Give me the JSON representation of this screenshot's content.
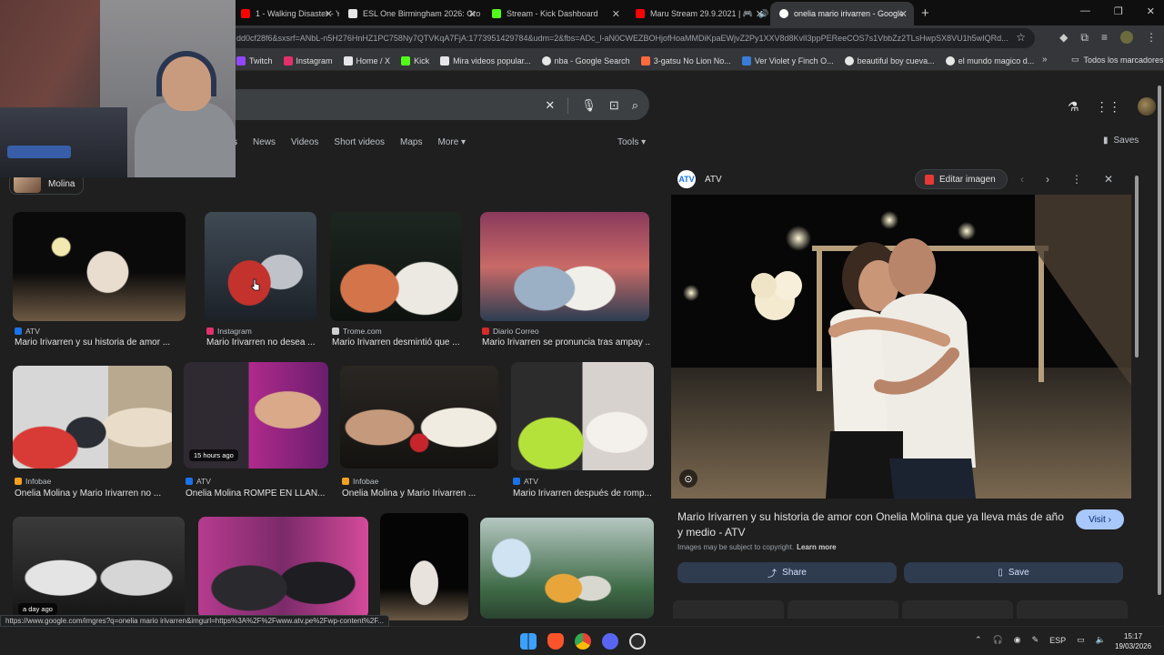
{
  "tabs": [
    {
      "title": "1 - Walking Disaster - Yo",
      "color": "#ff0000"
    },
    {
      "title": "ESL One Birmingham 2026: Gro",
      "color": "#e6e6e6"
    },
    {
      "title": "Stream - Kick Dashboard",
      "color": "#53fc18"
    },
    {
      "title": "Maru Stream 29.9.2021 | 🎮",
      "color": "#ff0000"
    },
    {
      "title": "onelia mario irivarren - Google",
      "color": "#4285f4"
    }
  ],
  "address_bar": {
    "url": "dd0cf28f6&sxsrf=ANbL-n5H276HnHZ1PC758Ny7QTVKqA7FjA:1773951429784&udm=2&fbs=ADc_l-aN0CWEZBOHjofHoaMMDiKpaEWjvZ2Py1XXV8d8KvlI3ppPEReeCOS7s1VbbZz2TLsHwpSX8VU1h5wIQRd..."
  },
  "bookmarks": [
    {
      "label": "Twitch",
      "color": "#9146ff"
    },
    {
      "label": "Instagram",
      "color": "#e1306c"
    },
    {
      "label": "Home / X",
      "color": "#e6e6e6"
    },
    {
      "label": "Kick",
      "color": "#53fc18"
    },
    {
      "label": "Mira videos popular...",
      "color": "#e6e6e6"
    },
    {
      "label": "nba - Google Search",
      "color": "#e6e6e6"
    },
    {
      "label": "3-gatsu No Lion No...",
      "color": "#ff6b3d"
    },
    {
      "label": "Ver Violet y Finch O...",
      "color": "#3a7bd5"
    },
    {
      "label": "beautiful boy cueva...",
      "color": "#e6e6e6"
    },
    {
      "label": "el mundo magico d...",
      "color": "#e6e6e6"
    }
  ],
  "bookmarks_all": "Todos los marcadores",
  "nav": {
    "tabs": [
      "s",
      "News",
      "Videos",
      "Short videos",
      "Maps",
      "More"
    ],
    "tools": "Tools",
    "saves": "Saves"
  },
  "chip": {
    "label": "Molina"
  },
  "results": [
    {
      "source": "ATV",
      "caption": "Mario Irivarren y su historia de amor ...",
      "color": "#1a73e8"
    },
    {
      "source": "Instagram",
      "caption": "Mario Irivarren no desea ...",
      "color": "#e1306c"
    },
    {
      "source": "Trome.com",
      "caption": "Mario Irivarren desmintió que ...",
      "color": "#d0d0d0"
    },
    {
      "source": "Diario Correo",
      "caption": "Mario Irivarren se pronuncia tras ampay ...",
      "color": "#d62b2b"
    },
    {
      "source": "Infobae",
      "caption": "Onelia Molina y Mario Irivarren no ...",
      "color": "#f4a020"
    },
    {
      "source": "ATV",
      "caption": "Onelia Molina ROMPE EN LLAN...",
      "color": "#1a73e8",
      "badge": "15 hours ago"
    },
    {
      "source": "Infobae",
      "caption": "Onelia Molina y Mario Irivarren ...",
      "color": "#f4a020"
    },
    {
      "source": "ATV",
      "caption": "Mario Irivarren después de romp...",
      "color": "#1a73e8"
    },
    {
      "badge": "a day ago"
    }
  ],
  "panel": {
    "source": "ATV",
    "logo": "ATV",
    "edit_label": "Editar imagen",
    "title": "Mario Irivarren y su historia de amor con Onelia Molina que ya lleva más de año y medio - ATV",
    "visit_label": "Visit",
    "copyright": "Images may be subject to copyright.",
    "learn_more": "Learn more",
    "share_label": "Share",
    "save_label": "Save"
  },
  "status_url": "https://www.google.com/imgres?q=onelia mario irivarren&imgurl=https%3A%2F%2Fwww.atv.pe%2Fwp-content%2F...",
  "taskbar": {
    "lang": "ESP",
    "time": "15:17",
    "date": "19/03/2026"
  }
}
